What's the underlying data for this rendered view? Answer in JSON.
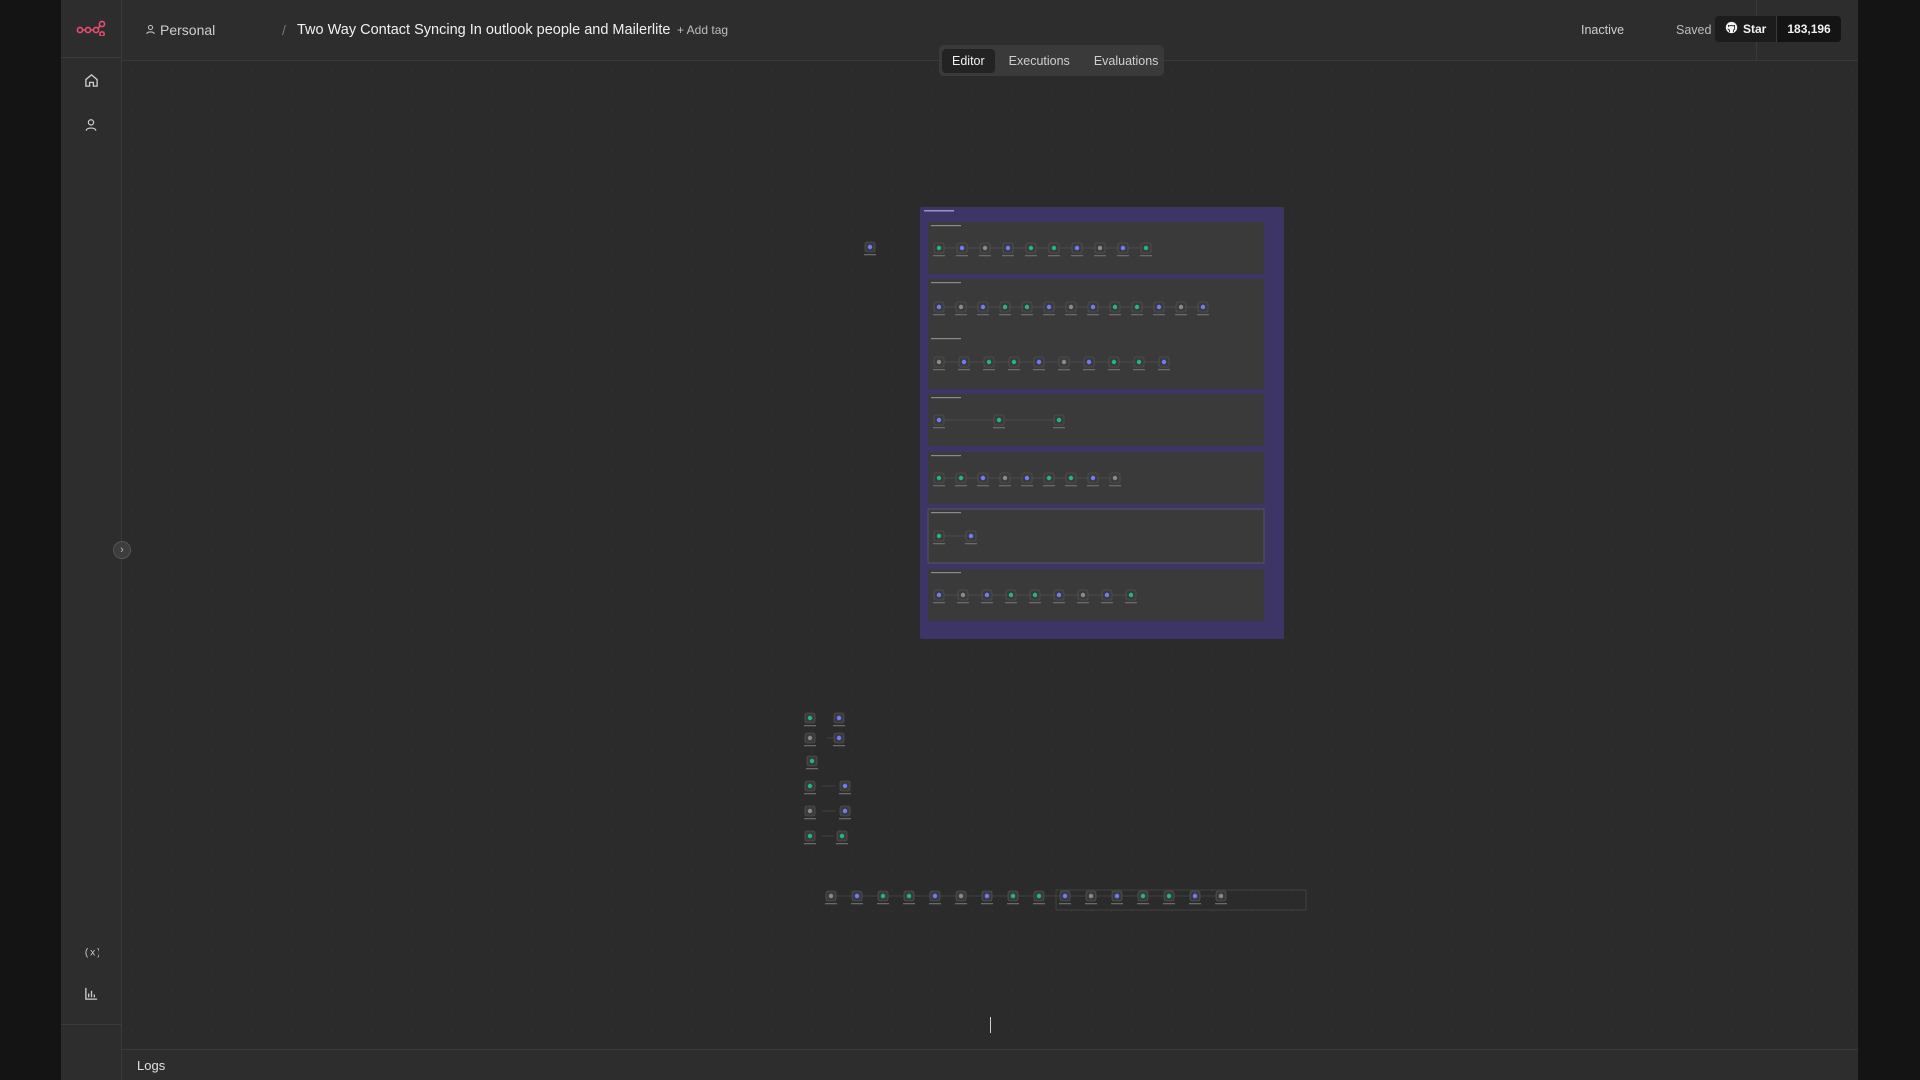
{
  "header": {
    "project": "Personal",
    "separator": "/",
    "workflow_title": "Two Way Contact Syncing In outlook people and Mailerlite",
    "add_tag": "+ Add tag",
    "status": "Inactive",
    "save_state": "Saved",
    "github": {
      "star_label": "Star",
      "star_count": "183,196"
    }
  },
  "tabs": [
    {
      "label": "Editor",
      "active": true
    },
    {
      "label": "Executions",
      "active": false
    },
    {
      "label": "Evaluations",
      "active": false
    }
  ],
  "rail": {
    "top_icons": [
      "n8n-logo-icon",
      "home-icon",
      "user-icon"
    ],
    "bottom_icons": [
      "variables-icon",
      "insights-chart-icon"
    ]
  },
  "footer": {
    "logs_label": "Logs"
  },
  "colors": {
    "background": "#2b2b2b",
    "sticky_note": "#3d3566",
    "node_green": "#1fb97e",
    "node_blue": "#6f7cff",
    "brand": "#ea4b71"
  }
}
